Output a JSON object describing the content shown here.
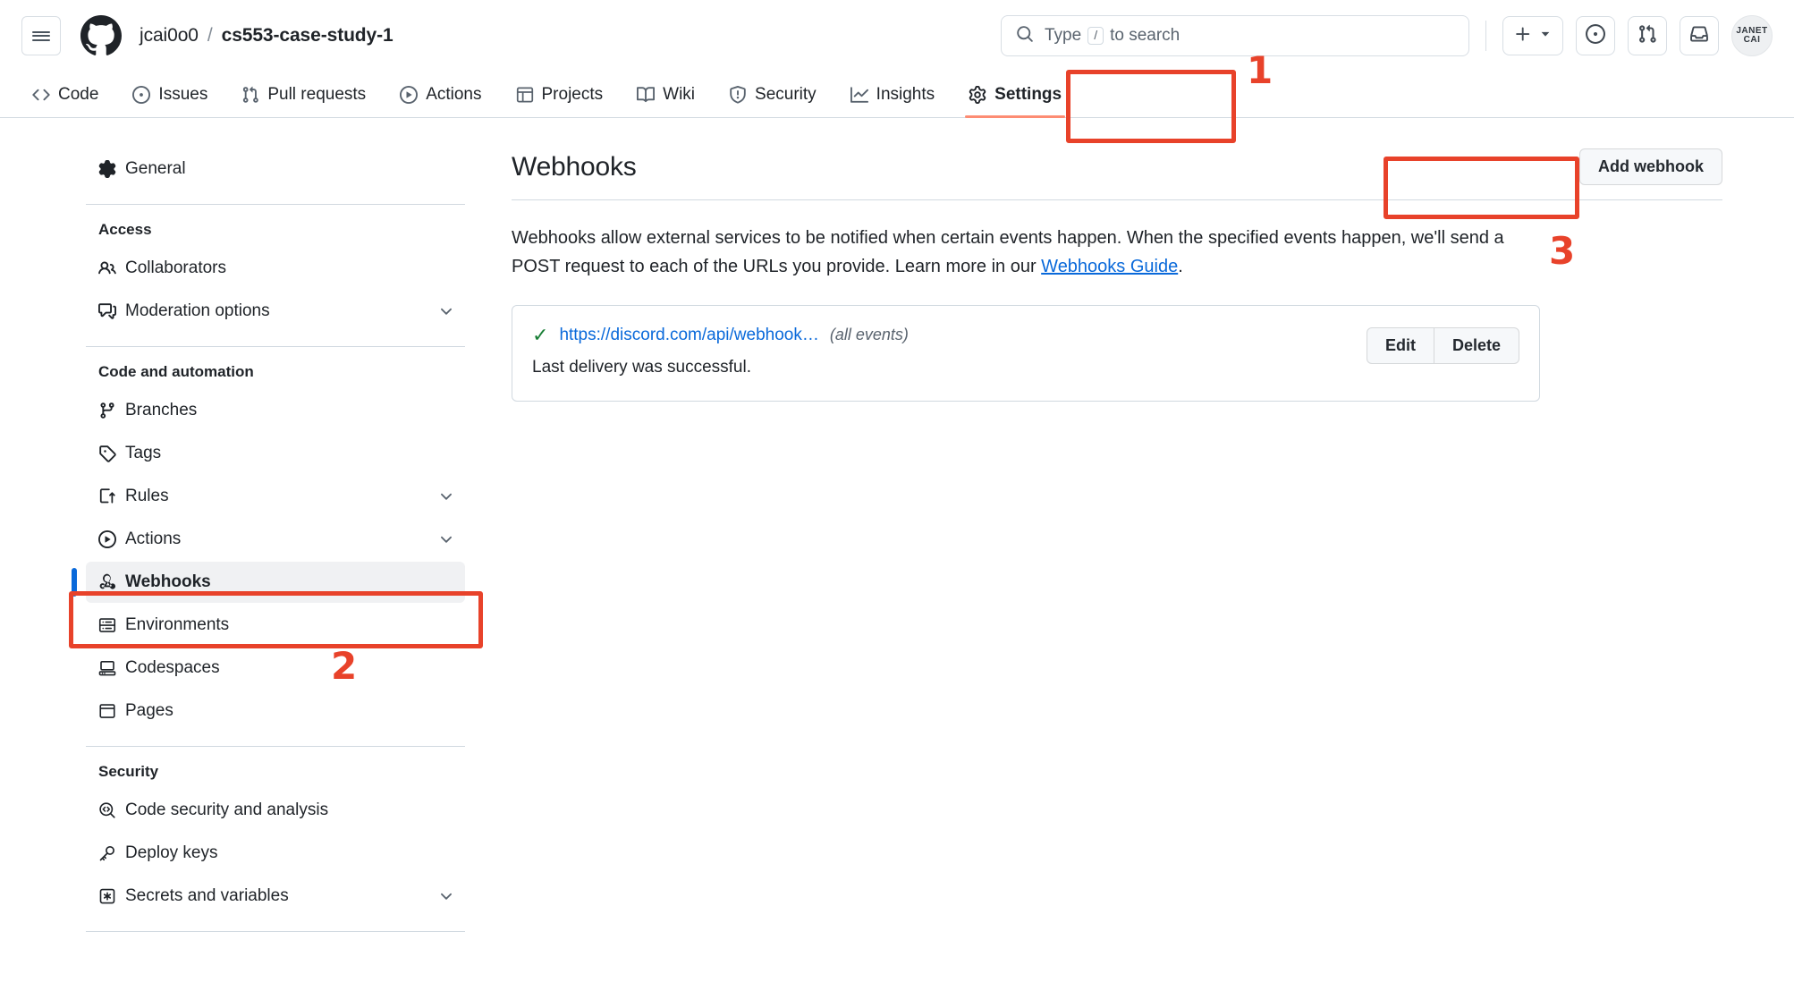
{
  "header": {
    "menu_icon": "hamburger-icon",
    "logo_icon": "github-logo-icon",
    "owner": "jcai0o0",
    "separator": "/",
    "repo": "cs553-case-study-1",
    "search": {
      "icon": "search-icon",
      "placeholder_prefix": "Type",
      "key_hint": "/",
      "placeholder_suffix": "to search"
    },
    "actions": [
      {
        "name": "create-new-button",
        "icon": "plus-icon",
        "has_caret": true
      },
      {
        "name": "issues-button",
        "icon": "issue-opened-icon"
      },
      {
        "name": "pull-requests-button",
        "icon": "git-pull-request-icon"
      },
      {
        "name": "notifications-button",
        "icon": "inbox-icon"
      }
    ],
    "avatar": {
      "line1": "JANET",
      "line2": "CAI"
    }
  },
  "repo_nav": {
    "items": [
      {
        "label": "Code",
        "icon": "code-icon",
        "active": false
      },
      {
        "label": "Issues",
        "icon": "issue-opened-icon",
        "active": false
      },
      {
        "label": "Pull requests",
        "icon": "git-pull-request-icon",
        "active": false
      },
      {
        "label": "Actions",
        "icon": "play-icon",
        "active": false
      },
      {
        "label": "Projects",
        "icon": "table-icon",
        "active": false
      },
      {
        "label": "Wiki",
        "icon": "book-icon",
        "active": false
      },
      {
        "label": "Security",
        "icon": "shield-icon",
        "active": false
      },
      {
        "label": "Insights",
        "icon": "graph-icon",
        "active": false
      },
      {
        "label": "Settings",
        "icon": "gear-icon",
        "active": true
      }
    ]
  },
  "sidebar": {
    "top": [
      {
        "label": "General",
        "icon": "gear-icon",
        "chevron": false,
        "selected": false
      }
    ],
    "sections": [
      {
        "heading": "Access",
        "items": [
          {
            "label": "Collaborators",
            "icon": "people-icon",
            "chevron": false,
            "selected": false
          },
          {
            "label": "Moderation options",
            "icon": "comment-discussion-icon",
            "chevron": true,
            "selected": false
          }
        ]
      },
      {
        "heading": "Code and automation",
        "items": [
          {
            "label": "Branches",
            "icon": "git-branch-icon",
            "chevron": false,
            "selected": false
          },
          {
            "label": "Tags",
            "icon": "tag-icon",
            "chevron": false,
            "selected": false
          },
          {
            "label": "Rules",
            "icon": "rules-icon",
            "chevron": true,
            "selected": false
          },
          {
            "label": "Actions",
            "icon": "play-icon",
            "chevron": true,
            "selected": false
          },
          {
            "label": "Webhooks",
            "icon": "webhook-icon",
            "chevron": false,
            "selected": true
          },
          {
            "label": "Environments",
            "icon": "server-icon",
            "chevron": false,
            "selected": false
          },
          {
            "label": "Codespaces",
            "icon": "codespaces-icon",
            "chevron": false,
            "selected": false
          },
          {
            "label": "Pages",
            "icon": "browser-icon",
            "chevron": false,
            "selected": false
          }
        ]
      },
      {
        "heading": "Security",
        "items": [
          {
            "label": "Code security and analysis",
            "icon": "codescan-icon",
            "chevron": false,
            "selected": false
          },
          {
            "label": "Deploy keys",
            "icon": "key-icon",
            "chevron": false,
            "selected": false
          },
          {
            "label": "Secrets and variables",
            "icon": "asterisk-icon",
            "chevron": true,
            "selected": false
          }
        ]
      }
    ]
  },
  "main": {
    "title": "Webhooks",
    "add_button": "Add webhook",
    "description_part1": "Webhooks allow external services to be notified when certain events happen. When the specified events happen, we'll send a POST request to each of the URLs you provide. Learn more in our ",
    "description_link": "Webhooks Guide",
    "description_part2": ".",
    "webhooks": [
      {
        "status_icon": "check-icon",
        "url": "https://discord.com/api/webhook…",
        "events": "(all events)",
        "delivery_status": "Last delivery was successful.",
        "edit_label": "Edit",
        "delete_label": "Delete"
      }
    ]
  },
  "annotations": [
    {
      "number": "1",
      "target": "settings-tab"
    },
    {
      "number": "2",
      "target": "sidebar-item-webhooks"
    },
    {
      "number": "3",
      "target": "add-webhook-button"
    }
  ],
  "colors": {
    "annotation": "#e8422a",
    "link": "#0969da",
    "active_tab_underline": "#fd8c73",
    "success": "#1a7f37",
    "selected_bar": "#0969da"
  }
}
